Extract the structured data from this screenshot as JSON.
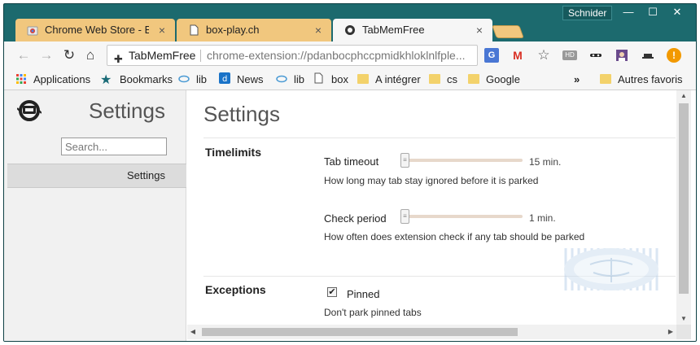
{
  "window": {
    "user": "Schnider",
    "controls": {
      "minimize": "—",
      "maximize": "☐",
      "close": "✕"
    }
  },
  "tabs": [
    {
      "label": "Chrome Web Store - Exte",
      "close": "×",
      "icon": "chrome-store-icon"
    },
    {
      "label": "box-play.ch",
      "close": "×",
      "icon": "page-icon"
    },
    {
      "label": "TabMemFree",
      "close": "×",
      "icon": "tabmemfree-icon"
    }
  ],
  "toolbar": {
    "back": "←",
    "forward": "→",
    "reload": "↻",
    "home": "⌂",
    "site_name": "TabMemFree",
    "url": "chrome-extension://pdanbocphccpmidkhloklnlfple...",
    "extensions": [
      "translate-icon",
      "gmail-icon",
      "bookmark-star-icon",
      "hd-icon",
      "mask-icon",
      "avatar-ext-icon",
      "hat-icon",
      "alert-icon"
    ]
  },
  "bookmarks": {
    "items": [
      {
        "label": "Applications",
        "icon": "apps-grid-icon"
      },
      {
        "label": "Bookmarks",
        "icon": "star-icon"
      },
      {
        "label": "lib",
        "icon": "lib-icon"
      },
      {
        "label": "News",
        "icon": "news-icon"
      },
      {
        "label": "lib",
        "icon": "lib-icon"
      },
      {
        "label": "box",
        "icon": "page-icon"
      },
      {
        "label": "A intégrer",
        "icon": "folder-icon"
      },
      {
        "label": "cs",
        "icon": "folder-icon"
      },
      {
        "label": "Google",
        "icon": "folder-icon"
      }
    ],
    "overflow": "»",
    "other": "Autres favoris"
  },
  "sidebar": {
    "title": "Settings",
    "search_placeholder": "Search...",
    "nav": [
      {
        "label": "Settings"
      }
    ]
  },
  "main": {
    "title": "Settings",
    "sections": {
      "timelimits": {
        "title": "Timelimits",
        "tab_timeout": {
          "label": "Tab timeout",
          "value": "15 min.",
          "level": 0.0,
          "description": "How long may tab stay ignored before it is parked"
        },
        "check_period": {
          "label": "Check period",
          "value": "1 min.",
          "level": 0.0,
          "description": "How often does extension check if any tab should be parked"
        }
      },
      "exceptions": {
        "title": "Exceptions",
        "pinned": {
          "label": "Pinned",
          "checked": true,
          "check_glyph": "✔",
          "description": "Don't park pinned tabs"
        }
      }
    }
  },
  "colors": {
    "frame": "#1c6a6e",
    "tab_inactive": "#f1c77e",
    "tab_active": "#f6f6f6",
    "sidebar_bg": "#f1f1f1",
    "slider_track": "#e7d8cb"
  }
}
